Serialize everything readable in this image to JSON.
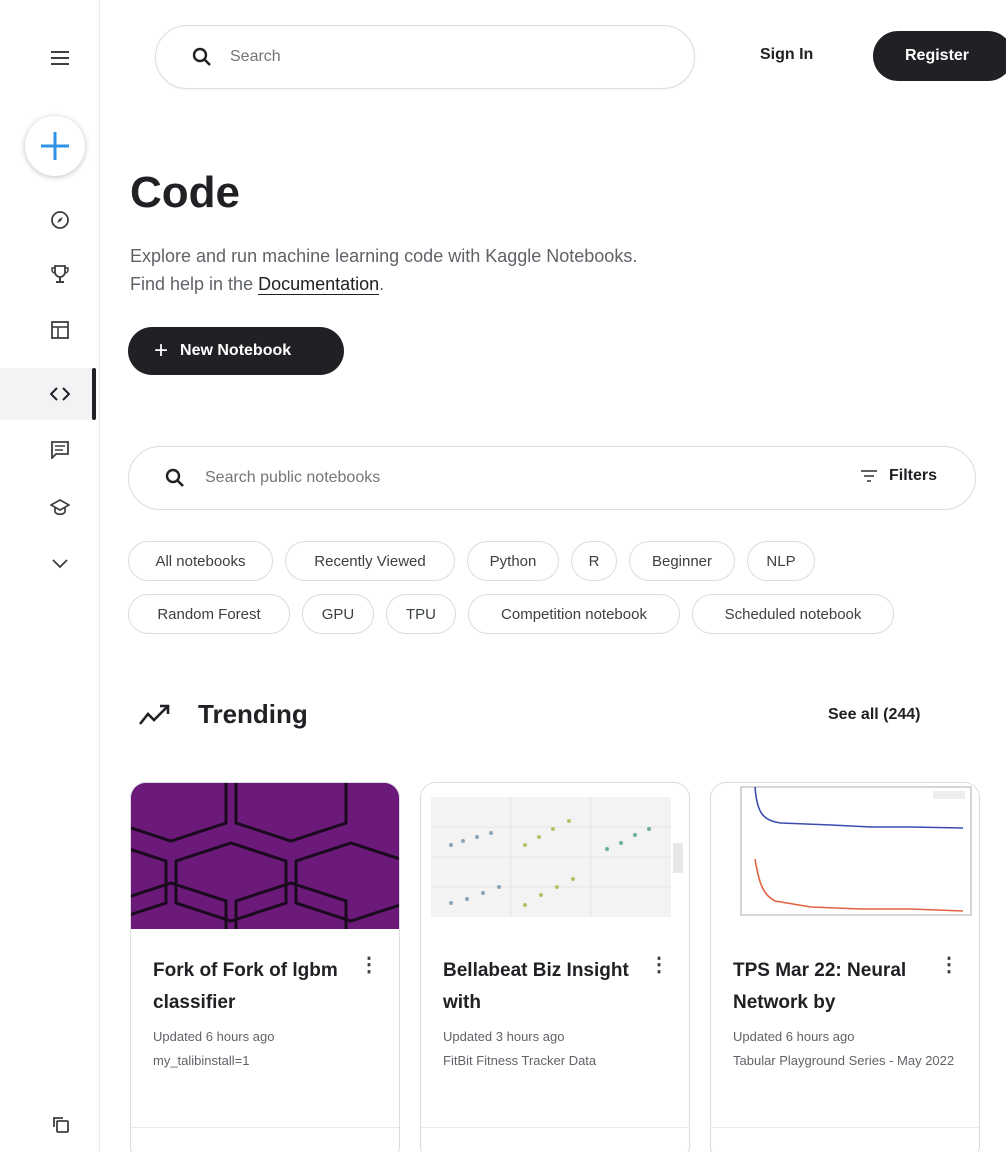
{
  "header": {
    "search_placeholder": "Search",
    "sign_in": "Sign In",
    "register": "Register"
  },
  "sidebar": {
    "items": [
      {
        "icon": "compass-icon"
      },
      {
        "icon": "trophy-icon"
      },
      {
        "icon": "table-icon"
      },
      {
        "icon": "code-icon",
        "active": true
      },
      {
        "icon": "comments-icon"
      },
      {
        "icon": "school-icon"
      },
      {
        "icon": "chevron-down-icon"
      }
    ]
  },
  "page": {
    "title": "Code",
    "description_line1": "Explore and run machine learning code with Kaggle Notebooks.",
    "description_line2_prefix": "Find help in the ",
    "documentation_link": "Documentation",
    "description_line2_suffix": ".",
    "new_notebook": "New Notebook"
  },
  "notebook_search": {
    "placeholder": "Search public notebooks",
    "filters": "Filters"
  },
  "chips": [
    "All notebooks",
    "Recently Viewed",
    "Python",
    "R",
    "Beginner",
    "NLP",
    "Random Forest",
    "GPU",
    "TPU",
    "Competition notebook",
    "Scheduled notebook"
  ],
  "trending": {
    "title": "Trending",
    "see_all": "See all (244)"
  },
  "cards": [
    {
      "title": "Fork of Fork of lgbm classifier",
      "updated": "Updated 6 hours ago",
      "source": "my_talibinstall=1"
    },
    {
      "title": "Bellabeat Biz Insight with",
      "updated": "Updated 3 hours ago",
      "source": "FitBit Fitness Tracker Data"
    },
    {
      "title": "TPS Mar 22: Neural Network by",
      "updated": "Updated 6 hours ago",
      "source": "Tabular Playground Series - May 2022"
    }
  ],
  "colors": {
    "accent_blue": "#2e93e6",
    "dark": "#202124",
    "card1_bg": "#6b1a7a"
  }
}
